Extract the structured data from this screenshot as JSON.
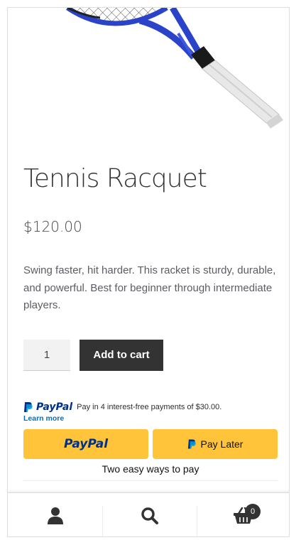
{
  "product": {
    "title": "Tennis Racquet",
    "price": "$120.00",
    "description": "Swing faster, hit harder. This racket is sturdy, durable, and powerful. Best for beginner through intermediate players.",
    "quantity": "1",
    "add_to_cart_label": "Add to cart"
  },
  "paypal": {
    "logo_text": "PayPal",
    "message": "Pay in 4 interest-free payments of $30.00.",
    "learn_more": "Learn more",
    "button_paypal_label": "PayPal",
    "button_pay_later_label": "Pay Later",
    "tagline": "Two easy ways to pay",
    "colors": {
      "button": "#ffc439",
      "dark_blue": "#003087",
      "light_blue": "#009cde"
    }
  },
  "footer": {
    "account_icon": "user-icon",
    "search_icon": "search-icon",
    "cart_icon": "basket-icon",
    "cart_count": "0"
  }
}
